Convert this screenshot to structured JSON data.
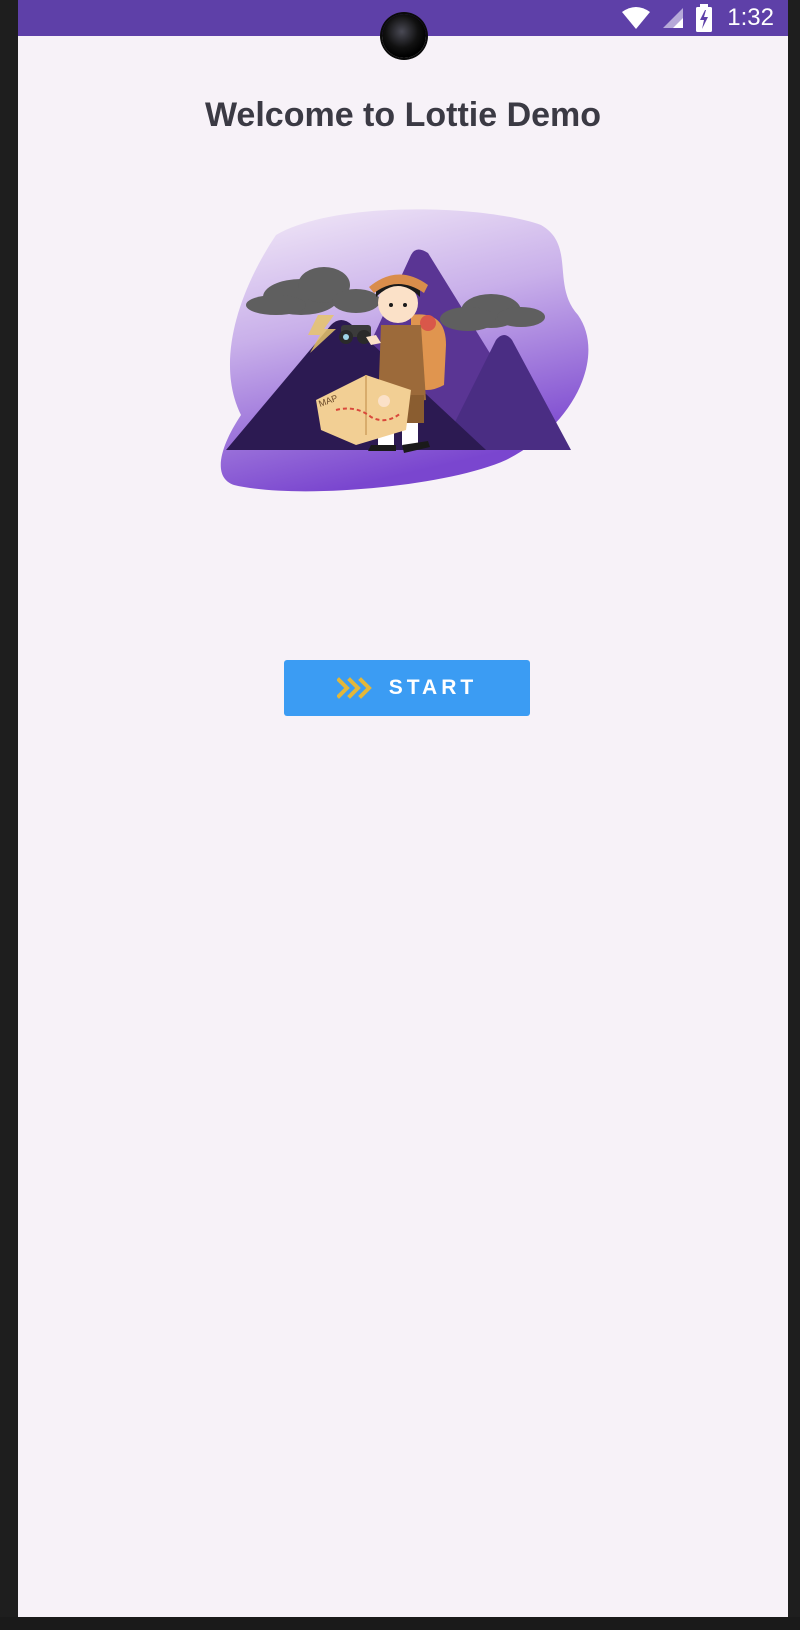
{
  "status_bar": {
    "time": "1:32",
    "icons": [
      "wifi-icon",
      "signal-icon",
      "battery-charging-icon"
    ],
    "background": "#5e40a8"
  },
  "page": {
    "title": "Welcome to Lottie Demo",
    "background": "#f7f2f8"
  },
  "illustration": {
    "map_label": "MAP",
    "colors": {
      "blob_top": "#efe3f6",
      "blob_bottom": "#7a46cf",
      "mountain_dark": "#2c1a52",
      "mountain_mid": "#5a3594",
      "cloud": "#5f5f5f",
      "backpack": "#e0954f"
    }
  },
  "start_button": {
    "label": "START",
    "icon": "chevrons-right-icon",
    "background": "#3b9cf3",
    "icon_color": "#e2b73a"
  }
}
